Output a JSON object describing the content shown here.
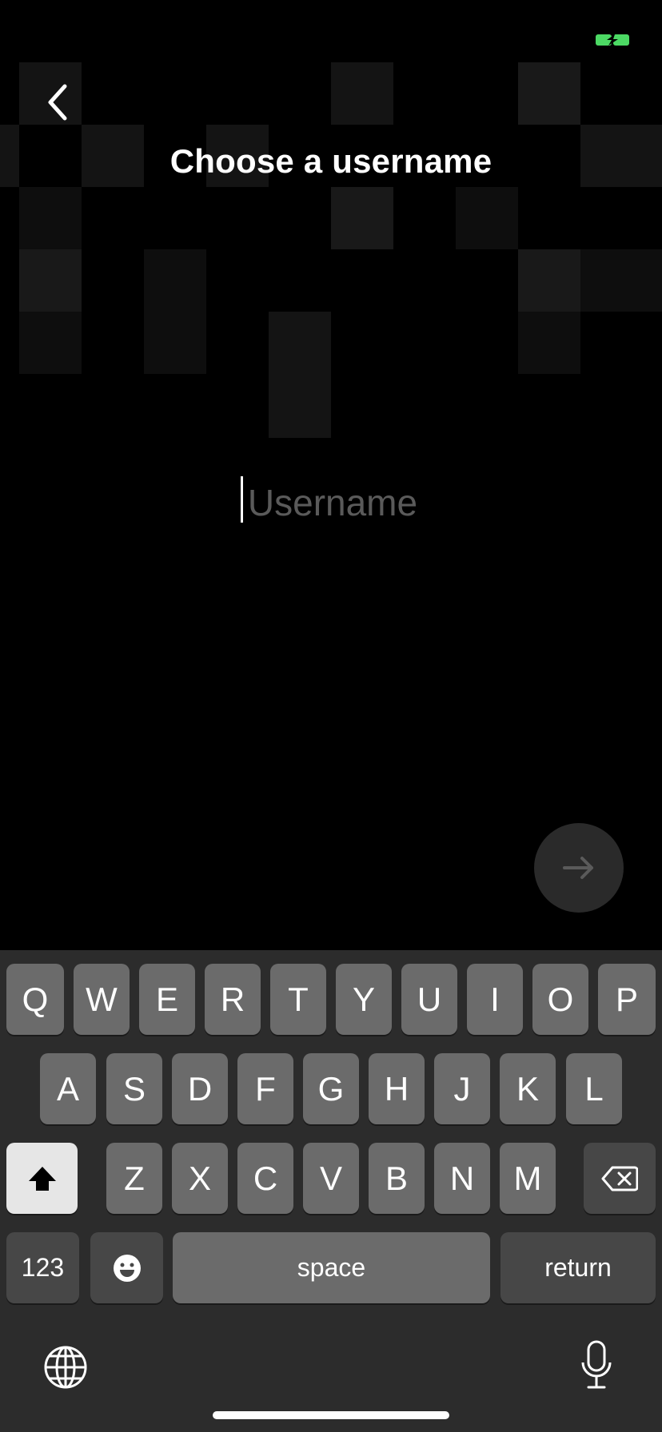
{
  "header": {
    "title": "Choose a username"
  },
  "form": {
    "username_placeholder": "Username",
    "username_value": ""
  },
  "keyboard": {
    "row1": [
      "Q",
      "W",
      "E",
      "R",
      "T",
      "Y",
      "U",
      "I",
      "O",
      "P"
    ],
    "row2": [
      "A",
      "S",
      "D",
      "F",
      "G",
      "H",
      "J",
      "K",
      "L"
    ],
    "row3": [
      "Z",
      "X",
      "C",
      "V",
      "B",
      "N",
      "M"
    ],
    "numbers_label": "123",
    "space_label": "space",
    "return_label": "return"
  },
  "colors": {
    "battery": "#4cd964",
    "next_button_bg": "#2a2a2a",
    "keyboard_bg": "#2c2c2c"
  },
  "icons": [
    "battery-icon",
    "back-arrow-icon",
    "arrow-right-icon",
    "shift-icon",
    "backspace-icon",
    "emoji-icon",
    "globe-icon",
    "microphone-icon"
  ]
}
